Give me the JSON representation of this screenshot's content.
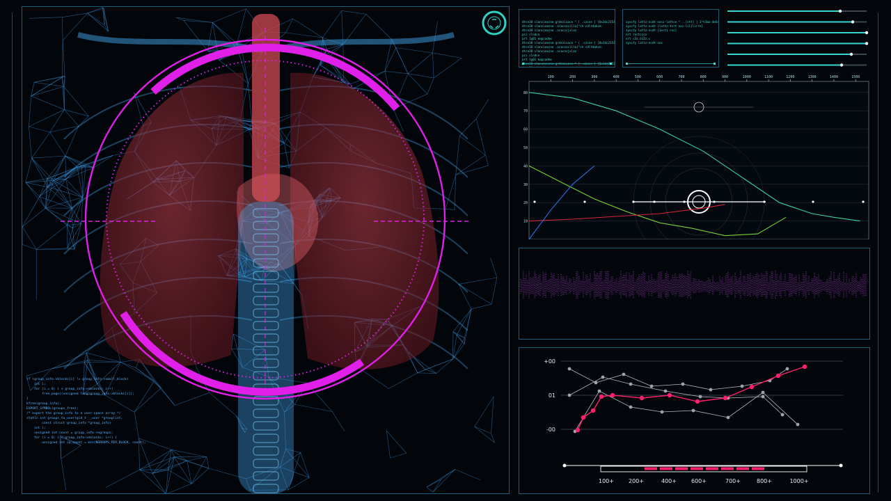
{
  "left_panel": {
    "code_lines": [
      "if (group_info->blocks[i] != group_info->small_block)",
      "    int i;",
      "    for (i = 0; i < group_info->nblocks; i++)",
      "        free_page((unsigned long)group_info->blocks[i]);",
      "}",
      "kfree(group_info);",
      "",
      "",
      "EXPORT_SYMBOL(groups_free);",
      "",
      "/* export the group_info to a user-space array */",
      "static int groups_to_user(gid_t __user *grouplist,",
      "        const struct group_info *group_info)",
      "",
      "    int i;",
      "    unsigned int count = group_info->ngroups;",
      "",
      "    for (i = 0; i < group_info->nblocks; i++) {",
      "        unsigned int cp_count = min(NGROUPS_PER_BLOCK, count);"
    ]
  },
  "terminals": [
    {
      "lines": [
        "dtcn38 slanciexcne grdnzixace ^ [ .czcne ] [0x3dc21538'0> ~\\",
        "dtcn38 slanciexcne .xcaczxcilla[^ch cdltdakxe:",
        "dtcn38 slanciexcne .scaczcjxlaz",
        "pci clndce",
        "prt 1g01 mapcadmx",
        "",
        "dtcn38 slanciexcne grdnzixace ^ [ .czcne ] [0x3dc21538'0> ~\\",
        "dtcn38 slanciexcne .xcaczxcilla[^ch cdltdakxe:",
        "dtcn38 slanciexcne .scaczcjxlaz",
        "pci clndce",
        "prt 1g01 mapcadmx",
        "",
        "dtcn38 slanciexcne grdnzixace ^ [ .czcne ] [0x3dc21538'0> ~\\",
        "dtcn38 cdztadsz:",
        "pci clndce",
        "prt 1g01 mapcadmx"
      ]
    },
    {
      "lines": [
        "zyxcfy lattz-ncdt nxnz-lattce ^ ..[ctt] ] 1^t3ma-4e6r-3] ~\\",
        "",
        "zyxcfy lattz-ncdt (lattz-tnrt nxz-lcl[lcrrn]",
        "zyxcfy lattz-ncdt [1ect1 rnc]",
        "nrt rnctcccx",
        "nrt c3z.b12z.c",
        "",
        "zyxcfy lattz-ncdt xxx"
      ]
    }
  ],
  "sliders": [
    0.81,
    0.9,
    1.0,
    1.0,
    0.89,
    0.82
  ],
  "chart_data": {
    "type": "line",
    "x_ticks": [
      100,
      200,
      300,
      400,
      500,
      600,
      700,
      800,
      900,
      1000,
      1100,
      1200,
      1300,
      1400,
      1500
    ],
    "y_ticks": [
      10,
      20,
      30,
      40,
      50,
      60,
      70,
      80
    ],
    "xlim": [
      0,
      1560
    ],
    "ylim": [
      0,
      86
    ],
    "series": [
      {
        "color": "#3ecf9a",
        "x": [
          0,
          200,
          400,
          600,
          800,
          1000,
          1150,
          1300,
          1400,
          1520
        ],
        "y": [
          80,
          77,
          70,
          60,
          48,
          32,
          20,
          14,
          12,
          10
        ]
      },
      {
        "color": "#78d23a",
        "x": [
          0,
          150,
          300,
          450,
          600,
          750,
          900,
          1050,
          1180
        ],
        "y": [
          40,
          31,
          22,
          15,
          9,
          6,
          2,
          3,
          12
        ]
      },
      {
        "color": "#d6263a",
        "x": [
          0,
          200,
          400,
          600,
          800,
          900
        ],
        "y": [
          10,
          11,
          12.5,
          14,
          17,
          19
        ]
      },
      {
        "color": "#2c6fe6",
        "x": [
          0,
          100,
          200,
          300
        ],
        "y": [
          0,
          16,
          30,
          40
        ]
      }
    ]
  },
  "lower_chart": {
    "y_labels": [
      "+00",
      "01",
      "-00"
    ],
    "x_labels": [
      "100+",
      "200+",
      "400+",
      "600+",
      "700+",
      "800+",
      "1000+"
    ]
  },
  "colors": {
    "accent": "#e020e8",
    "cyan": "#3ee0d6",
    "pink": "#ff1f6a",
    "frame": "#1d5f7e"
  }
}
